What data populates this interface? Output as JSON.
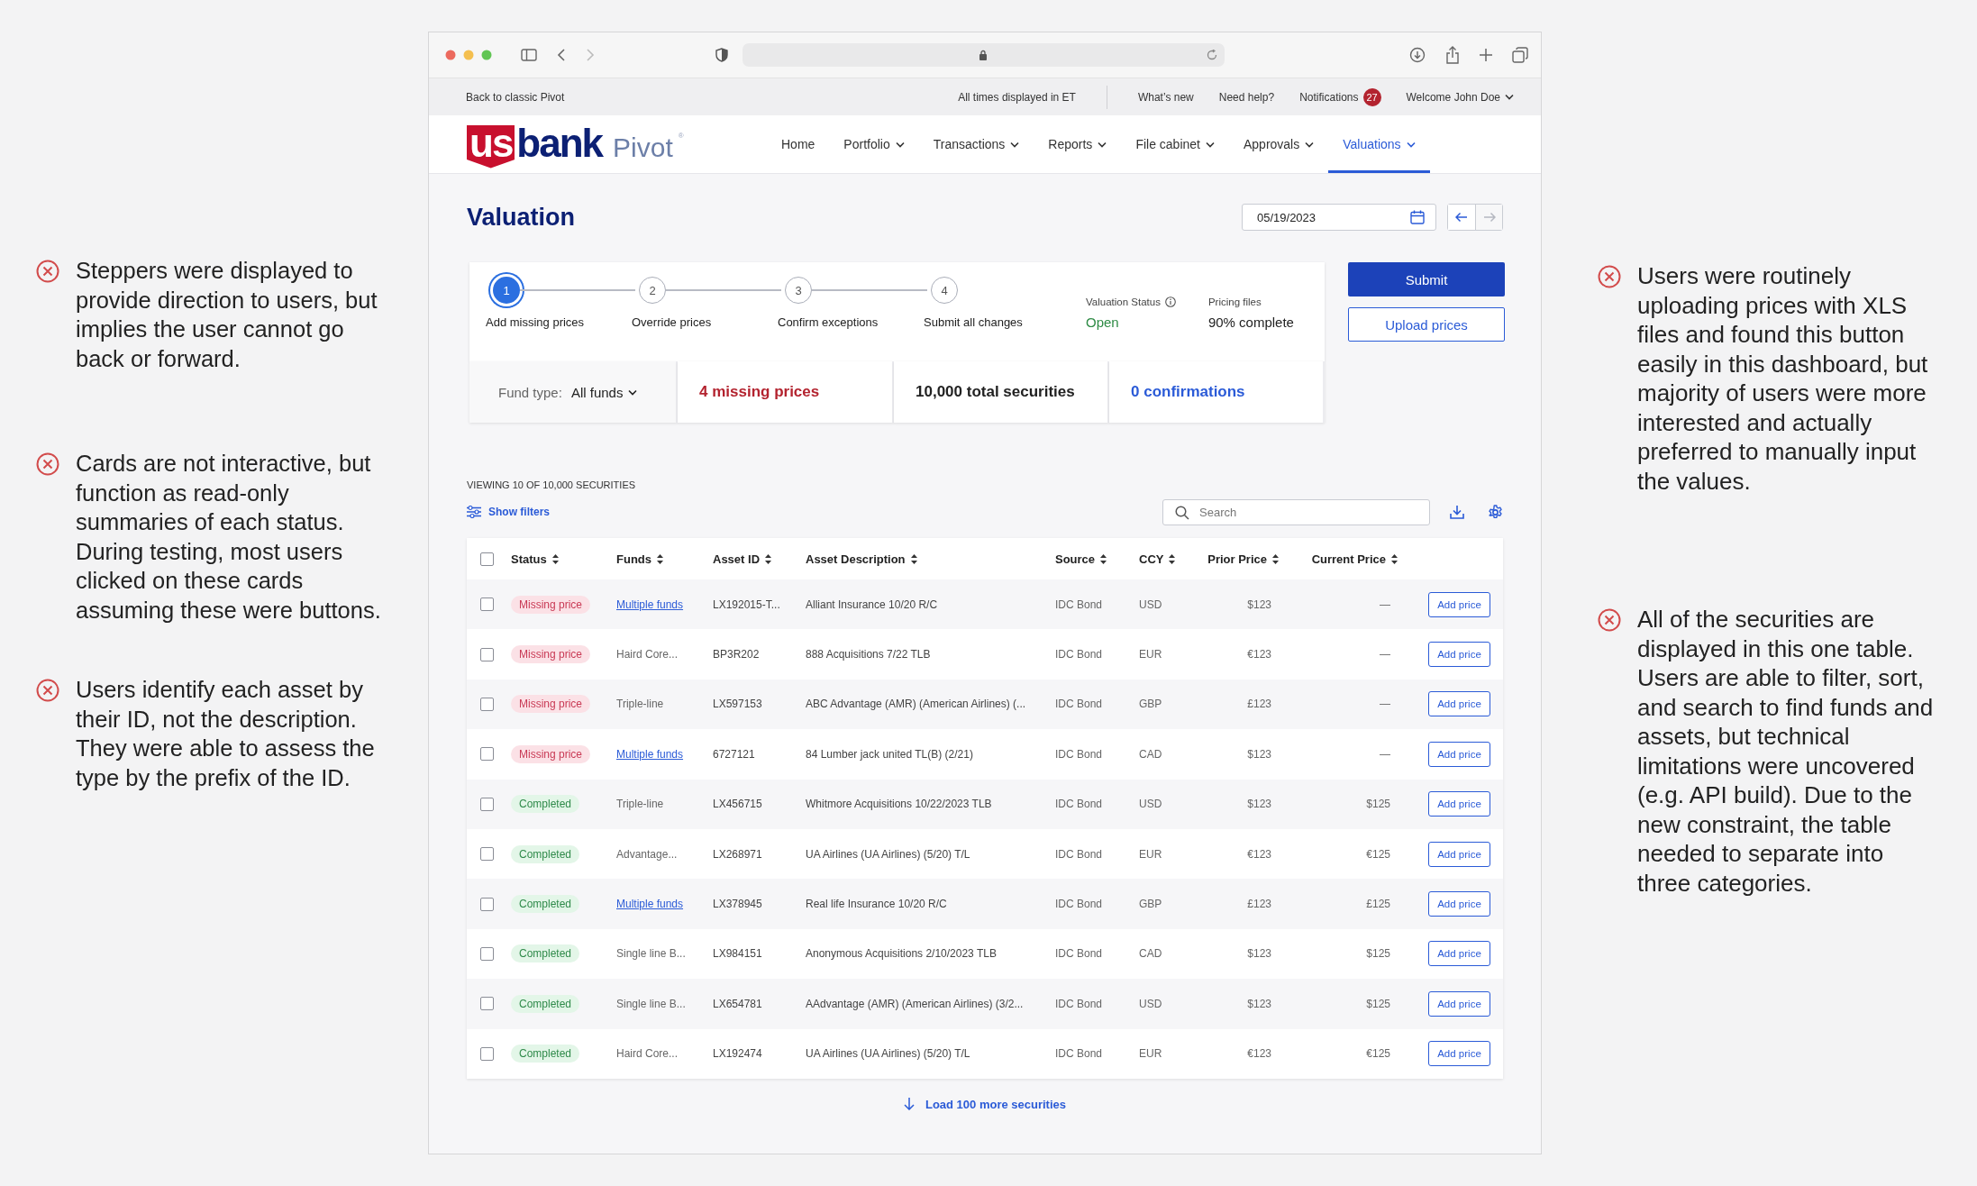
{
  "annotations_left": [
    {
      "text": "Steppers were displayed to provide direction to users, but implies the user cannot go back or forward."
    },
    {
      "text": "Cards are not interactive, but function as read-only summaries of each status. During testing, most users clicked on these cards assuming these were buttons."
    },
    {
      "text": "Users identify each asset by their ID, not the description. They were able to assess the type by the prefix of the ID."
    }
  ],
  "utility_bar": {
    "back_link": "Back to classic Pivot",
    "timezone": "All times displayed in ET",
    "links": [
      "What’s new",
      "Need help?"
    ],
    "notifications": {
      "label": "Notifications",
      "count": "27"
    },
    "user": "Welcome John Doe"
  },
  "logo": {
    "mark": "us",
    "name": "bank",
    "product": "Pivot",
    "registered": "®"
  },
  "nav": [
    {
      "label": "Home",
      "dropdown": false,
      "selected": false
    },
    {
      "label": "Portfolio",
      "dropdown": true,
      "selected": false
    },
    {
      "label": "Transactions",
      "dropdown": true,
      "selected": false
    },
    {
      "label": "Reports",
      "dropdown": true,
      "selected": false
    },
    {
      "label": "File cabinet",
      "dropdown": true,
      "selected": false
    },
    {
      "label": "Approvals",
      "dropdown": true,
      "selected": false
    },
    {
      "label": "Valuations",
      "dropdown": true,
      "selected": true
    }
  ],
  "page": {
    "title": "Valuation",
    "date": "05/19/2023",
    "date_nav": [
      {
        "disabled": false
      },
      {
        "disabled": true
      }
    ]
  },
  "stepper": {
    "steps": [
      {
        "number": "1",
        "label": "Add missing prices",
        "selected": true
      },
      {
        "number": "2",
        "label": "Override prices",
        "selected": false
      },
      {
        "number": "3",
        "label": "Confirm exceptions",
        "selected": false
      },
      {
        "number": "4",
        "label": "Submit all changes",
        "selected": false
      }
    ]
  },
  "status": [
    {
      "label": "Valuation Status",
      "value": "Open",
      "info": true,
      "kind": "positive"
    },
    {
      "label": "Pricing files",
      "value": "90% complete",
      "info": false,
      "kind": "neutral"
    }
  ],
  "actions": [
    {
      "label": "Submit",
      "kind": "primary"
    },
    {
      "label": "Upload prices",
      "kind": "secondary"
    }
  ],
  "summary": {
    "fund_type_label": "Fund type:",
    "fund_type_value": "All funds",
    "cards": [
      {
        "text": "4 missing prices",
        "kind": "danger"
      },
      {
        "text": "10,000 total securities",
        "kind": "neutral"
      },
      {
        "text": "0 confirmations",
        "kind": "info"
      }
    ]
  },
  "table_info": "VIEWING 10 OF 10,000 SECURITIES",
  "show_filters": "Show filters",
  "search": {
    "placeholder": "Search"
  },
  "table": {
    "select_all_checked": false,
    "columns": [
      {
        "label": "Status"
      },
      {
        "label": "Funds"
      },
      {
        "label": "Asset ID"
      },
      {
        "label": "Asset Description"
      },
      {
        "label": "Source"
      },
      {
        "label": "CCY"
      },
      {
        "label": "Prior Price"
      },
      {
        "label": "Current Price"
      }
    ],
    "rows": [
      {
        "checked": false,
        "status": "Missing price",
        "kind": "missing",
        "funds": "Multiple funds",
        "funds_link": true,
        "asset_id": "LX192015-T...",
        "description": "Alliant Insurance 10/20 R/C",
        "source": "IDC Bond",
        "ccy": "USD",
        "prior_price": "$123",
        "current_price": "—",
        "action": "Add price"
      },
      {
        "checked": false,
        "status": "Missing price",
        "kind": "missing",
        "funds": "Haird Core...",
        "funds_link": false,
        "asset_id": "BP3R202",
        "description": "888 Acquisitions 7/22 TLB",
        "source": "IDC Bond",
        "ccy": "EUR",
        "prior_price": "€123",
        "current_price": "—",
        "action": "Add price"
      },
      {
        "checked": false,
        "status": "Missing price",
        "kind": "missing",
        "funds": "Triple-line",
        "funds_link": false,
        "asset_id": "LX597153",
        "description": "ABC Advantage (AMR) (American Airlines) (...",
        "source": "IDC Bond",
        "ccy": "GBP",
        "prior_price": "£123",
        "current_price": "—",
        "action": "Add price"
      },
      {
        "checked": false,
        "status": "Missing price",
        "kind": "missing",
        "funds": "Multiple funds",
        "funds_link": true,
        "asset_id": "6727121",
        "description": "84 Lumber jack united TL(B) (2/21)",
        "source": "IDC Bond",
        "ccy": "CAD",
        "prior_price": "$123",
        "current_price": "—",
        "action": "Add price"
      },
      {
        "checked": false,
        "status": "Completed",
        "kind": "completed",
        "funds": "Triple-line",
        "funds_link": false,
        "asset_id": "LX456715",
        "description": "Whitmore Acquisitions 10/22/2023 TLB",
        "source": "IDC Bond",
        "ccy": "USD",
        "prior_price": "$123",
        "current_price": "$125",
        "action": "Add price"
      },
      {
        "checked": false,
        "status": "Completed",
        "kind": "completed",
        "funds": "Advantage...",
        "funds_link": false,
        "asset_id": "LX268971",
        "description": "UA Airlines (UA Airlines) (5/20) T/L",
        "source": "IDC Bond",
        "ccy": "EUR",
        "prior_price": "€123",
        "current_price": "€125",
        "action": "Add price"
      },
      {
        "checked": false,
        "status": "Completed",
        "kind": "completed",
        "funds": "Multiple funds",
        "funds_link": true,
        "asset_id": "LX378945",
        "description": "Real life Insurance 10/20 R/C",
        "source": "IDC Bond",
        "ccy": "GBP",
        "prior_price": "£123",
        "current_price": "£125",
        "action": "Add price"
      },
      {
        "checked": false,
        "status": "Completed",
        "kind": "completed",
        "funds": "Single line B...",
        "funds_link": false,
        "asset_id": "LX984151",
        "description": "Anonymous Acquisitions 2/10/2023 TLB",
        "source": "IDC Bond",
        "ccy": "CAD",
        "prior_price": "$123",
        "current_price": "$125",
        "action": "Add price"
      },
      {
        "checked": false,
        "status": "Completed",
        "kind": "completed",
        "funds": "Single line B...",
        "funds_link": false,
        "asset_id": "LX654781",
        "description": "AAdvantage (AMR) (American Airlines) (3/2...",
        "source": "IDC Bond",
        "ccy": "USD",
        "prior_price": "$123",
        "current_price": "$125",
        "action": "Add price"
      },
      {
        "checked": false,
        "status": "Completed",
        "kind": "completed",
        "funds": "Haird Core...",
        "funds_link": false,
        "asset_id": "LX192474",
        "description": "UA Airlines (UA Airlines) (5/20) T/L",
        "source": "IDC Bond",
        "ccy": "EUR",
        "prior_price": "€123",
        "current_price": "€125",
        "action": "Add price"
      }
    ]
  },
  "load_more": "Load 100 more securities",
  "annotations_right": [
    {
      "text": "Users were routinely uploading prices with XLS files and found this button easily in this dashboard, but majority of users were more interested and actually preferred to manually input the values."
    },
    {
      "text": "All of the securities are displayed in this one table. Users are able to filter, sort, and search to find funds and assets, but technical limitations were uncovered (e.g. API build). Due to the new constraint, the table needed to separate into three categories."
    }
  ]
}
